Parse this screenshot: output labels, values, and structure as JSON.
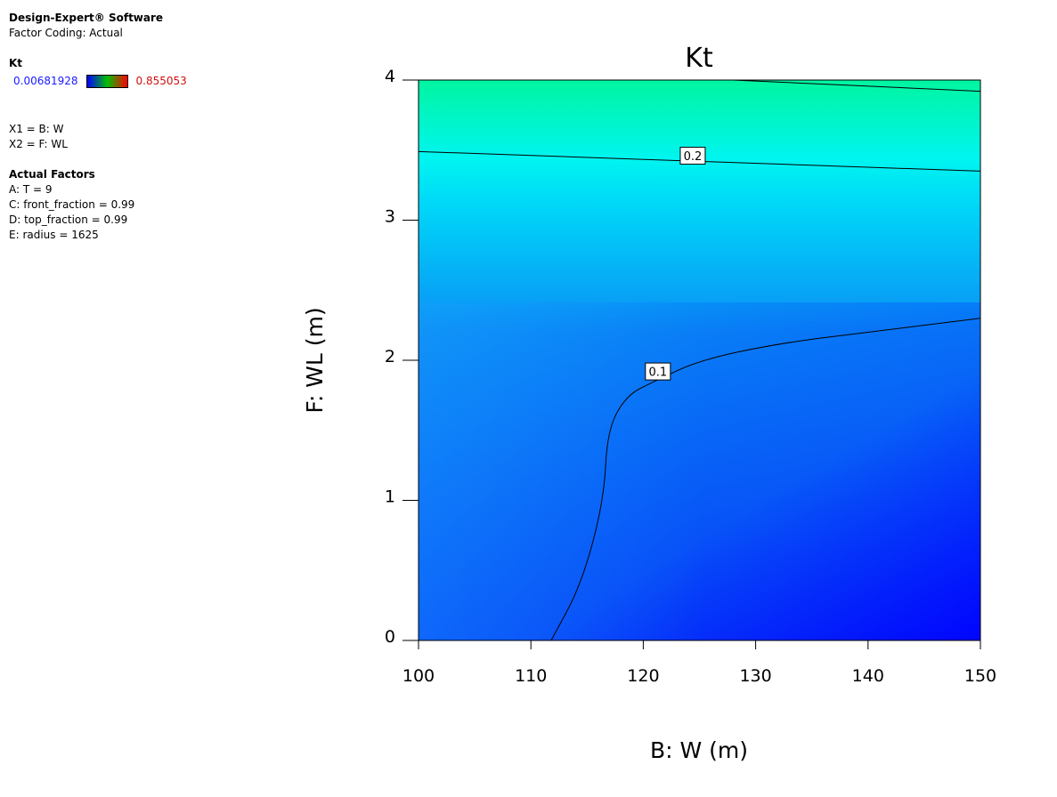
{
  "sidebar": {
    "app_title": "Design-Expert® Software",
    "factor_coding": "Factor Coding: Actual",
    "response_label": "Kt",
    "legend_min": "0.00681928",
    "legend_max": "0.855053",
    "x1": "X1 = B: W",
    "x2": "X2 = F: WL",
    "actual_factors_title": "Actual Factors",
    "factors": [
      "A: T = 9",
      "C: front_fraction = 0.99",
      "D: top_fraction = 0.99",
      "E: radius = 1625"
    ]
  },
  "colors": {
    "legend_low": "#0000ff",
    "legend_mid": "#00c000",
    "legend_high": "#ff0000",
    "contour_line": "#000000"
  },
  "chart_data": {
    "type": "heatmap",
    "subtype": "contour",
    "title": "Kt",
    "xlabel": "B: W (m)",
    "ylabel": "F: WL (m)",
    "xlim": [
      100,
      150
    ],
    "ylim": [
      0,
      4
    ],
    "x_ticks": [
      "100",
      "110",
      "120",
      "130",
      "140",
      "150"
    ],
    "y_ticks": [
      "0",
      "1",
      "2",
      "3",
      "4"
    ],
    "grid": false,
    "color_scale": {
      "min": 0.00681928,
      "max": 0.855053
    },
    "contours": [
      {
        "level": "0.1",
        "points": [
          [
            111.8,
            0
          ],
          [
            114.5,
            0.4
          ],
          [
            116.5,
            1.0
          ],
          [
            116.8,
            1.5
          ],
          [
            118.5,
            1.75
          ],
          [
            121,
            1.85
          ],
          [
            125,
            2.0
          ],
          [
            132,
            2.12
          ],
          [
            140,
            2.2
          ],
          [
            150,
            2.3
          ]
        ],
        "label_at": [
          121.3,
          1.92
        ]
      },
      {
        "level": "0.2",
        "points": [
          [
            100,
            3.49
          ],
          [
            150,
            3.35
          ]
        ],
        "label_at": [
          124.4,
          3.46
        ]
      },
      {
        "level": "",
        "points": [
          [
            128,
            4.0
          ],
          [
            150,
            3.92
          ]
        ],
        "label_at": null
      }
    ]
  }
}
